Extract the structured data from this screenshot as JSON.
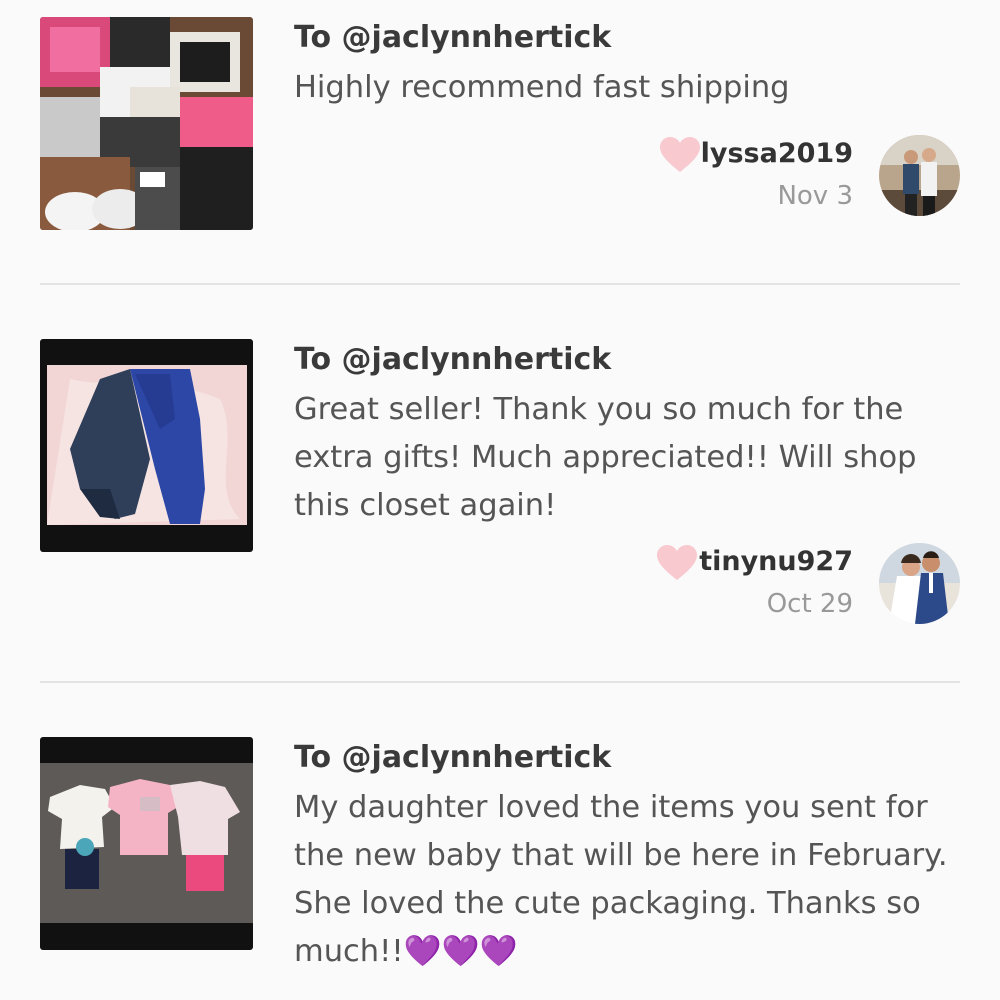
{
  "colors": {
    "background": "#fbfafb",
    "heart": "#f8c9cf",
    "divider": "#e3e2e4",
    "emoji_heart": "#9b30d9"
  },
  "reviews": [
    {
      "to": "To @jaclynnhertick",
      "comment": "Highly recommend fast shipping",
      "username": "lyssa2019",
      "date": "Nov 3"
    },
    {
      "to": "To @jaclynnhertick",
      "comment": "Great seller! Thank you so much for the extra gifts! Much appreciated!! Will shop this closet again!",
      "username": "tinynu927",
      "date": "Oct 29"
    },
    {
      "to": "To @jaclynnhertick",
      "comment": "My daughter loved the items you sent for the new baby that will be here in February. She loved the cute packaging. Thanks so much!!",
      "emoji": "💜💜💜"
    }
  ]
}
